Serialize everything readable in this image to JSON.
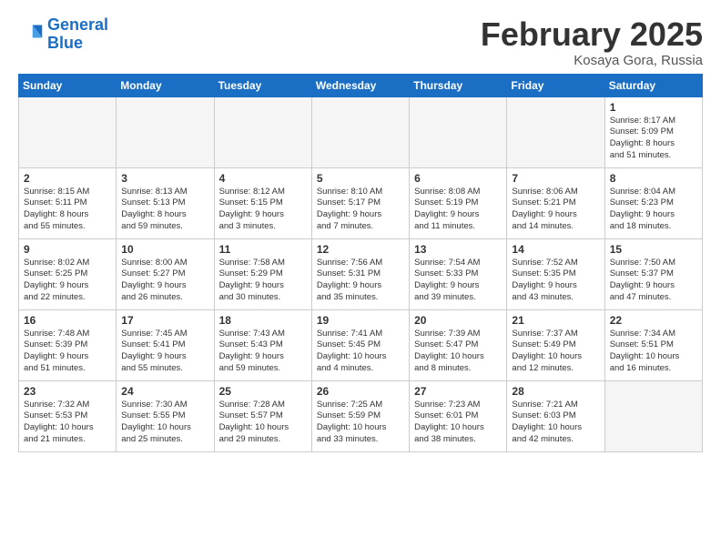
{
  "header": {
    "logo_line1": "General",
    "logo_line2": "Blue",
    "title": "February 2025",
    "subtitle": "Kosaya Gora, Russia"
  },
  "weekdays": [
    "Sunday",
    "Monday",
    "Tuesday",
    "Wednesday",
    "Thursday",
    "Friday",
    "Saturday"
  ],
  "weeks": [
    [
      {
        "day": "",
        "info": ""
      },
      {
        "day": "",
        "info": ""
      },
      {
        "day": "",
        "info": ""
      },
      {
        "day": "",
        "info": ""
      },
      {
        "day": "",
        "info": ""
      },
      {
        "day": "",
        "info": ""
      },
      {
        "day": "1",
        "info": "Sunrise: 8:17 AM\nSunset: 5:09 PM\nDaylight: 8 hours\nand 51 minutes."
      }
    ],
    [
      {
        "day": "2",
        "info": "Sunrise: 8:15 AM\nSunset: 5:11 PM\nDaylight: 8 hours\nand 55 minutes."
      },
      {
        "day": "3",
        "info": "Sunrise: 8:13 AM\nSunset: 5:13 PM\nDaylight: 8 hours\nand 59 minutes."
      },
      {
        "day": "4",
        "info": "Sunrise: 8:12 AM\nSunset: 5:15 PM\nDaylight: 9 hours\nand 3 minutes."
      },
      {
        "day": "5",
        "info": "Sunrise: 8:10 AM\nSunset: 5:17 PM\nDaylight: 9 hours\nand 7 minutes."
      },
      {
        "day": "6",
        "info": "Sunrise: 8:08 AM\nSunset: 5:19 PM\nDaylight: 9 hours\nand 11 minutes."
      },
      {
        "day": "7",
        "info": "Sunrise: 8:06 AM\nSunset: 5:21 PM\nDaylight: 9 hours\nand 14 minutes."
      },
      {
        "day": "8",
        "info": "Sunrise: 8:04 AM\nSunset: 5:23 PM\nDaylight: 9 hours\nand 18 minutes."
      }
    ],
    [
      {
        "day": "9",
        "info": "Sunrise: 8:02 AM\nSunset: 5:25 PM\nDaylight: 9 hours\nand 22 minutes."
      },
      {
        "day": "10",
        "info": "Sunrise: 8:00 AM\nSunset: 5:27 PM\nDaylight: 9 hours\nand 26 minutes."
      },
      {
        "day": "11",
        "info": "Sunrise: 7:58 AM\nSunset: 5:29 PM\nDaylight: 9 hours\nand 30 minutes."
      },
      {
        "day": "12",
        "info": "Sunrise: 7:56 AM\nSunset: 5:31 PM\nDaylight: 9 hours\nand 35 minutes."
      },
      {
        "day": "13",
        "info": "Sunrise: 7:54 AM\nSunset: 5:33 PM\nDaylight: 9 hours\nand 39 minutes."
      },
      {
        "day": "14",
        "info": "Sunrise: 7:52 AM\nSunset: 5:35 PM\nDaylight: 9 hours\nand 43 minutes."
      },
      {
        "day": "15",
        "info": "Sunrise: 7:50 AM\nSunset: 5:37 PM\nDaylight: 9 hours\nand 47 minutes."
      }
    ],
    [
      {
        "day": "16",
        "info": "Sunrise: 7:48 AM\nSunset: 5:39 PM\nDaylight: 9 hours\nand 51 minutes."
      },
      {
        "day": "17",
        "info": "Sunrise: 7:45 AM\nSunset: 5:41 PM\nDaylight: 9 hours\nand 55 minutes."
      },
      {
        "day": "18",
        "info": "Sunrise: 7:43 AM\nSunset: 5:43 PM\nDaylight: 9 hours\nand 59 minutes."
      },
      {
        "day": "19",
        "info": "Sunrise: 7:41 AM\nSunset: 5:45 PM\nDaylight: 10 hours\nand 4 minutes."
      },
      {
        "day": "20",
        "info": "Sunrise: 7:39 AM\nSunset: 5:47 PM\nDaylight: 10 hours\nand 8 minutes."
      },
      {
        "day": "21",
        "info": "Sunrise: 7:37 AM\nSunset: 5:49 PM\nDaylight: 10 hours\nand 12 minutes."
      },
      {
        "day": "22",
        "info": "Sunrise: 7:34 AM\nSunset: 5:51 PM\nDaylight: 10 hours\nand 16 minutes."
      }
    ],
    [
      {
        "day": "23",
        "info": "Sunrise: 7:32 AM\nSunset: 5:53 PM\nDaylight: 10 hours\nand 21 minutes."
      },
      {
        "day": "24",
        "info": "Sunrise: 7:30 AM\nSunset: 5:55 PM\nDaylight: 10 hours\nand 25 minutes."
      },
      {
        "day": "25",
        "info": "Sunrise: 7:28 AM\nSunset: 5:57 PM\nDaylight: 10 hours\nand 29 minutes."
      },
      {
        "day": "26",
        "info": "Sunrise: 7:25 AM\nSunset: 5:59 PM\nDaylight: 10 hours\nand 33 minutes."
      },
      {
        "day": "27",
        "info": "Sunrise: 7:23 AM\nSunset: 6:01 PM\nDaylight: 10 hours\nand 38 minutes."
      },
      {
        "day": "28",
        "info": "Sunrise: 7:21 AM\nSunset: 6:03 PM\nDaylight: 10 hours\nand 42 minutes."
      },
      {
        "day": "",
        "info": ""
      }
    ]
  ]
}
